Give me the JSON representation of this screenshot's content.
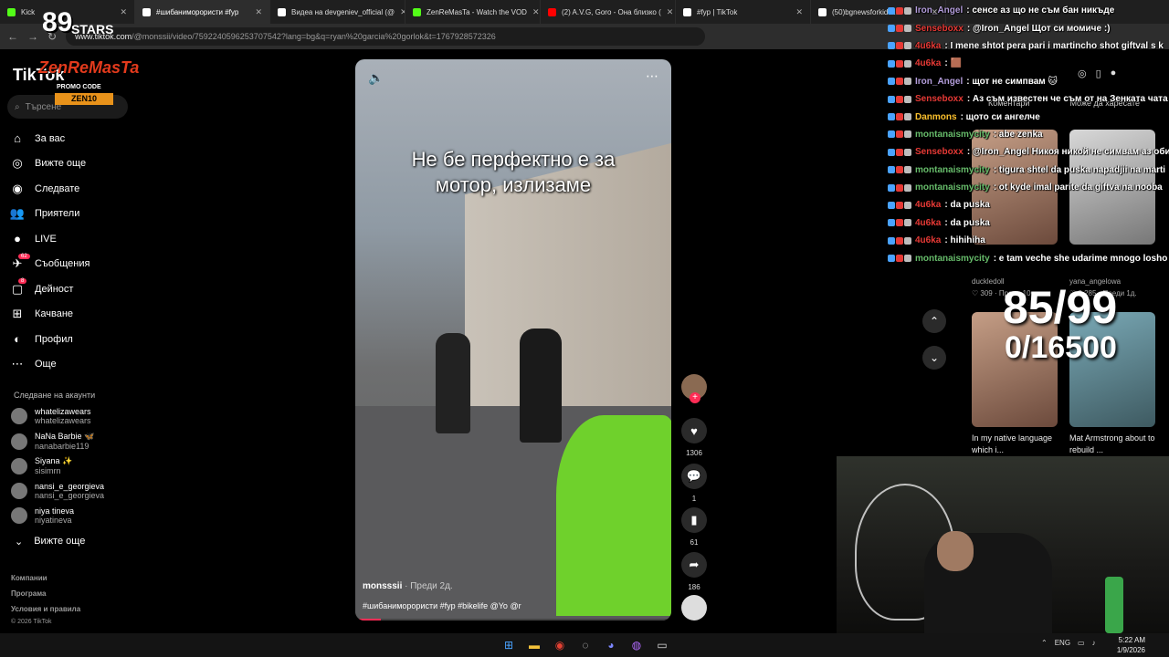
{
  "browser": {
    "tabs": [
      {
        "label": "Kick",
        "color": "#53fc18"
      },
      {
        "label": "#шибаниморористи #fyp",
        "color": "#ffffff"
      },
      {
        "label": "Видеа на devgeniev_official (@",
        "color": "#ffffff"
      },
      {
        "label": "ZenReMasTa - Watch the VOD",
        "color": "#53fc18"
      },
      {
        "label": "(2) A.V.G, Goro - Она близко (",
        "color": "#ff0000"
      },
      {
        "label": "#fyp | TikTok",
        "color": "#ffffff"
      },
      {
        "label": "(50)bgnewsforkids...",
        "color": "#ffffff"
      }
    ],
    "url_domain": "www.tiktok.com",
    "url_path": "/@monssii/video/7592240596253707542?lang=bg&q=ryan%20garcia%20gorlok&t=1767928572326"
  },
  "sidebar": {
    "logo": "TikTok",
    "search_placeholder": "Търсене",
    "menu": [
      {
        "label": "За вас",
        "icon": "home-icon",
        "glyph": "⌂"
      },
      {
        "label": "Вижте още",
        "icon": "compass-icon",
        "glyph": "◎"
      },
      {
        "label": "Следвате",
        "icon": "following-icon",
        "glyph": "◉"
      },
      {
        "label": "Приятели",
        "icon": "friends-icon",
        "glyph": "👥"
      },
      {
        "label": "LIVE",
        "icon": "live-icon",
        "glyph": "●"
      },
      {
        "label": "Съобщения",
        "icon": "messages-icon",
        "glyph": "✈",
        "badge": "62"
      },
      {
        "label": "Дейност",
        "icon": "activity-icon",
        "glyph": "▢",
        "badge": "8"
      },
      {
        "label": "Качване",
        "icon": "upload-icon",
        "glyph": "⊞"
      },
      {
        "label": "Профил",
        "icon": "profile-icon",
        "glyph": "◐"
      },
      {
        "label": "Още",
        "icon": "more-icon",
        "glyph": "⋯"
      }
    ],
    "following_header": "Следване на акаунти",
    "accounts": [
      {
        "name": "whatelizawears",
        "handle": "whatelizawears"
      },
      {
        "name": "NaNa Barbie 🦋",
        "handle": "nanabarbie119"
      },
      {
        "name": "Siyana ✨",
        "handle": "sisimrn"
      },
      {
        "name": "nansi_e_georgieva",
        "handle": "nansi_e_georgieva"
      },
      {
        "name": "niya tineva",
        "handle": "niyatineva"
      }
    ],
    "see_more": "Вижте още",
    "footer": [
      "Компании",
      "Програма",
      "Условия и правила",
      "© 2026 TikTok"
    ]
  },
  "overlay": {
    "stars_big": "89",
    "stars_word": "STARS",
    "brand": "ZenReMasTa",
    "promo_label": "PROMO CODE",
    "promo_code": "ZEN10"
  },
  "video": {
    "caption_line1": "Не бе перфектно е за",
    "caption_line2": "мотор, излизаме",
    "username": "monsssii",
    "ago": "· Преди 2д.",
    "tags": "#шибаниморористи #fyp #bikelife @Yo @r",
    "progress": 0.08
  },
  "actions": {
    "likes": "1306",
    "comments": "1",
    "saves": "61",
    "shares": "186"
  },
  "right_panel": {
    "tab_comments": "Коментари",
    "tab_liked": "Може да харесате",
    "cards": [
      {
        "title": "...",
        "user": "duckledoll",
        "likes": "♡ 309 · Преди 10ч."
      },
      {
        "title": "...",
        "user": "yana_angelowa",
        "likes": "♡ 2,285 · Преди 1д."
      },
      {
        "title": "In my native language which i...",
        "user": "",
        "likes": ""
      },
      {
        "title": "Mat Armstrong about to rebuild ...",
        "user": "",
        "likes": ""
      }
    ]
  },
  "counter": {
    "main": "85/99",
    "sub": "0/16500"
  },
  "chat": [
    {
      "user": "Iron_Angel",
      "color": "#b39ddb",
      "msg": ": сенсе аз що не съм бан никъде"
    },
    {
      "user": "Senseboxx",
      "color": "#e53935",
      "msg": ": @Iron_Angel Щот си момиче :)"
    },
    {
      "user": "4u6ka",
      "color": "#e53935",
      "msg": ": I mene shtot pera pari i martincho shot giftval s k"
    },
    {
      "user": "4u6ka",
      "color": "#e53935",
      "msg": ": 🟫"
    },
    {
      "user": "Iron_Angel",
      "color": "#b39ddb",
      "msg": ": щот не симпвам 🐱"
    },
    {
      "user": "Senseboxx",
      "color": "#e53935",
      "msg": ": Аз съм известен че съм от на Зенката чата чес"
    },
    {
      "user": "Danmons",
      "color": "#fbc02d",
      "msg": ": щото си ангелче"
    },
    {
      "user": "montanaismycity",
      "color": "#66bb6a",
      "msg": ": abe zenka"
    },
    {
      "user": "Senseboxx",
      "color": "#e53935",
      "msg": ": @Iron_Angel Никоя никой не симвам аз обича"
    },
    {
      "user": "montanaismycity",
      "color": "#66bb6a",
      "msg": ": tigura shtel da puska napadjii na marti"
    },
    {
      "user": "montanaismycity",
      "color": "#66bb6a",
      "msg": ": ot kyde imal parite da giftva na nooba"
    },
    {
      "user": "4u6ka",
      "color": "#e53935",
      "msg": ": da puska"
    },
    {
      "user": "4u6ka",
      "color": "#e53935",
      "msg": ": da puska"
    },
    {
      "user": "4u6ka",
      "color": "#e53935",
      "msg": ": hihihiha"
    },
    {
      "user": "montanaismycity",
      "color": "#66bb6a",
      "msg": ": e tam veche she udarime mnogo losho"
    }
  ],
  "taskbar": {
    "lang": "ENG",
    "time": "5:22 AM",
    "date": "1/9/2026"
  }
}
